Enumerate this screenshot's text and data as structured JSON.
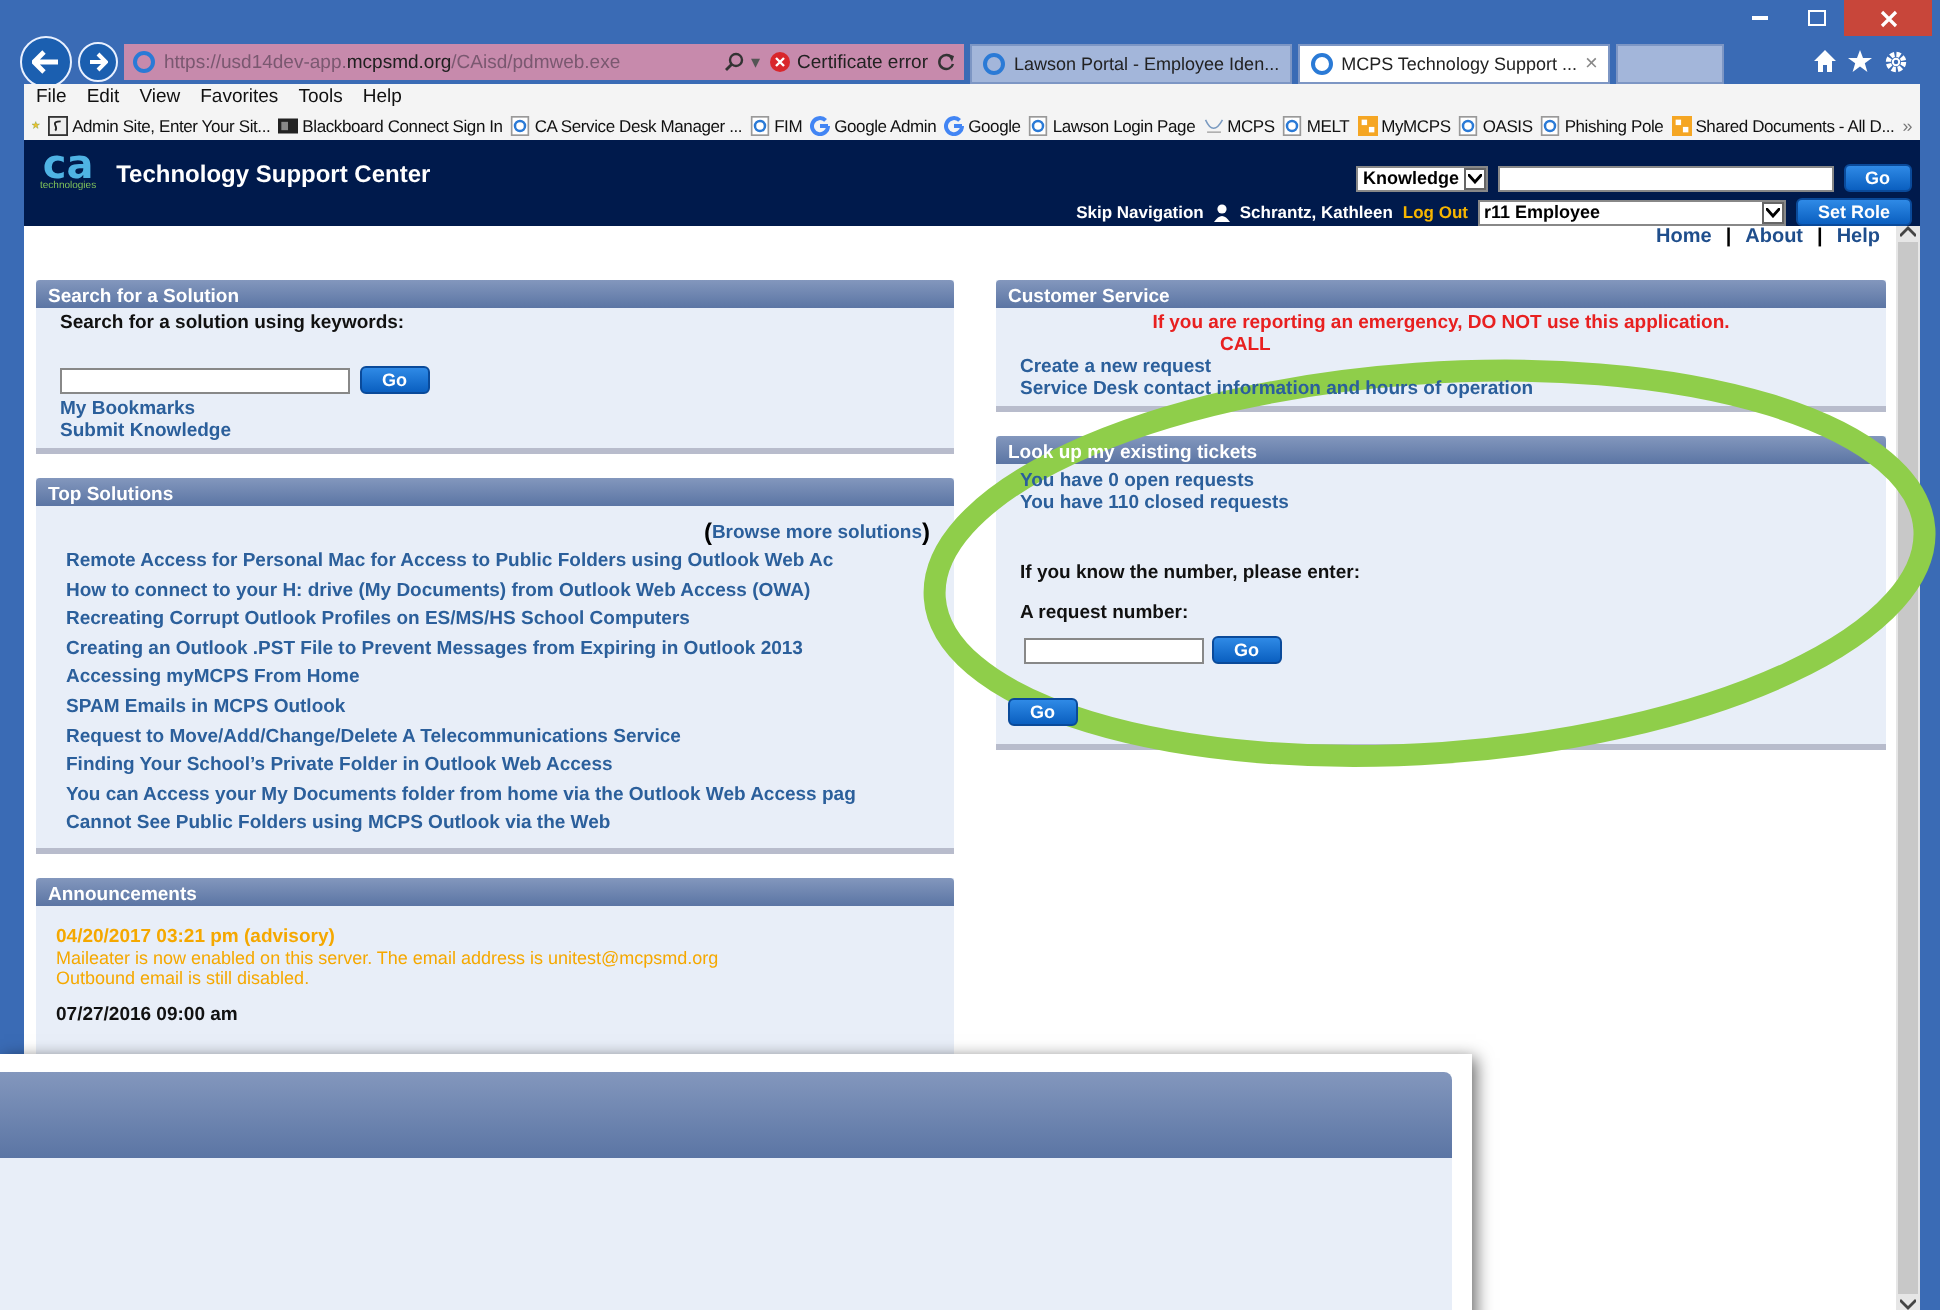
{
  "browser": {
    "address": "https://usd14dev-app.**mcpsmd.org**/CAisd/pdmweb.exe",
    "search_caret": "▾",
    "cert_error": "Certificate error",
    "tabs": [
      {
        "label": "Lawson Portal - Employee Iden...",
        "selected": false
      },
      {
        "label": "MCPS Technology Support ...",
        "selected": true
      }
    ],
    "tab_close": "×",
    "menu": [
      "File",
      "Edit",
      "View",
      "Favorites",
      "Tools",
      "Help"
    ],
    "favorites": [
      {
        "label": "Admin Site, Enter Your Sit...",
        "kind": "site"
      },
      {
        "label": "Blackboard Connect Sign In",
        "kind": "board"
      },
      {
        "label": "CA Service Desk Manager ...",
        "kind": "page"
      },
      {
        "label": "FIM",
        "kind": "page"
      },
      {
        "label": "Google Admin",
        "kind": "google"
      },
      {
        "label": "Google",
        "kind": "google"
      },
      {
        "label": "Lawson Login Page",
        "kind": "page"
      },
      {
        "label": "MCPS",
        "kind": "mcps"
      },
      {
        "label": "MELT",
        "kind": "page"
      },
      {
        "label": "MyMCPS",
        "kind": "tile"
      },
      {
        "label": "OASIS",
        "kind": "page"
      },
      {
        "label": "Phishing Pole",
        "kind": "page"
      },
      {
        "label": "Shared Documents - All D...",
        "kind": "tile"
      }
    ],
    "more": "»"
  },
  "header": {
    "logo": "ca",
    "logo_sub": "technologies",
    "title": "Technology Support Center",
    "scope": "Knowledge",
    "go": "Go",
    "skip": "Skip Navigation",
    "user": "Schrantz, Kathleen",
    "logout": "Log Out",
    "role": "r11 Employee",
    "set_role": "Set Role"
  },
  "top_links": {
    "items": [
      "Home",
      "About",
      "Help"
    ],
    "separator": "|"
  },
  "search_panel": {
    "title": "Search for a Solution",
    "label": "Search for a solution using keywords:",
    "go": "Go",
    "links": [
      "My Bookmarks",
      "Submit Knowledge"
    ]
  },
  "top_solutions": {
    "title": "Top Solutions",
    "browse_open": "(",
    "browse": "Browse more solutions",
    "browse_close": ")",
    "items": [
      "Remote Access for Personal Mac for Access to Public Folders using Outlook Web Ac",
      "How to connect to your H: drive (My Documents) from Outlook Web Access (OWA)",
      "Recreating Corrupt Outlook Profiles on ES/MS/HS School Computers",
      "Creating an Outlook .PST File to Prevent Messages from Expiring in Outlook 2013",
      "Accessing myMCPS From Home",
      "SPAM Emails in MCPS Outlook",
      "Request to Move/Add/Change/Delete A Telecommunications Service",
      "Finding Your School’s Private Folder in Outlook Web Access",
      "You can Access your My Documents folder from home via the Outlook Web Access pag",
      "Cannot See Public Folders using MCPS Outlook via the Web"
    ]
  },
  "announcements": {
    "title": "Announcements",
    "items": [
      {
        "kind": "advisory",
        "date": "04/20/2017 03:21 pm (advisory)",
        "lines": [
          "Maileater is now enabled on this server. The email address is unitest@mcpsmd.org",
          "Outbound email is still disabled."
        ]
      },
      {
        "kind": "normal",
        "date": "07/27/2016 09:00 am"
      }
    ]
  },
  "customer_service": {
    "title": "Customer Service",
    "warning": "If you are reporting an emergency, DO NOT use this application.",
    "warning_2": "CALL",
    "links": [
      "Create a new request",
      "Service Desk contact information and hours of operation"
    ]
  },
  "lookup": {
    "title": "Look up my existing tickets",
    "counts": [
      "You have 0 open requests",
      "You have 110 closed requests"
    ],
    "prompt": "If you know the number, please enter:",
    "field_label": "A request number:",
    "go": "Go",
    "go_2": "Go"
  }
}
